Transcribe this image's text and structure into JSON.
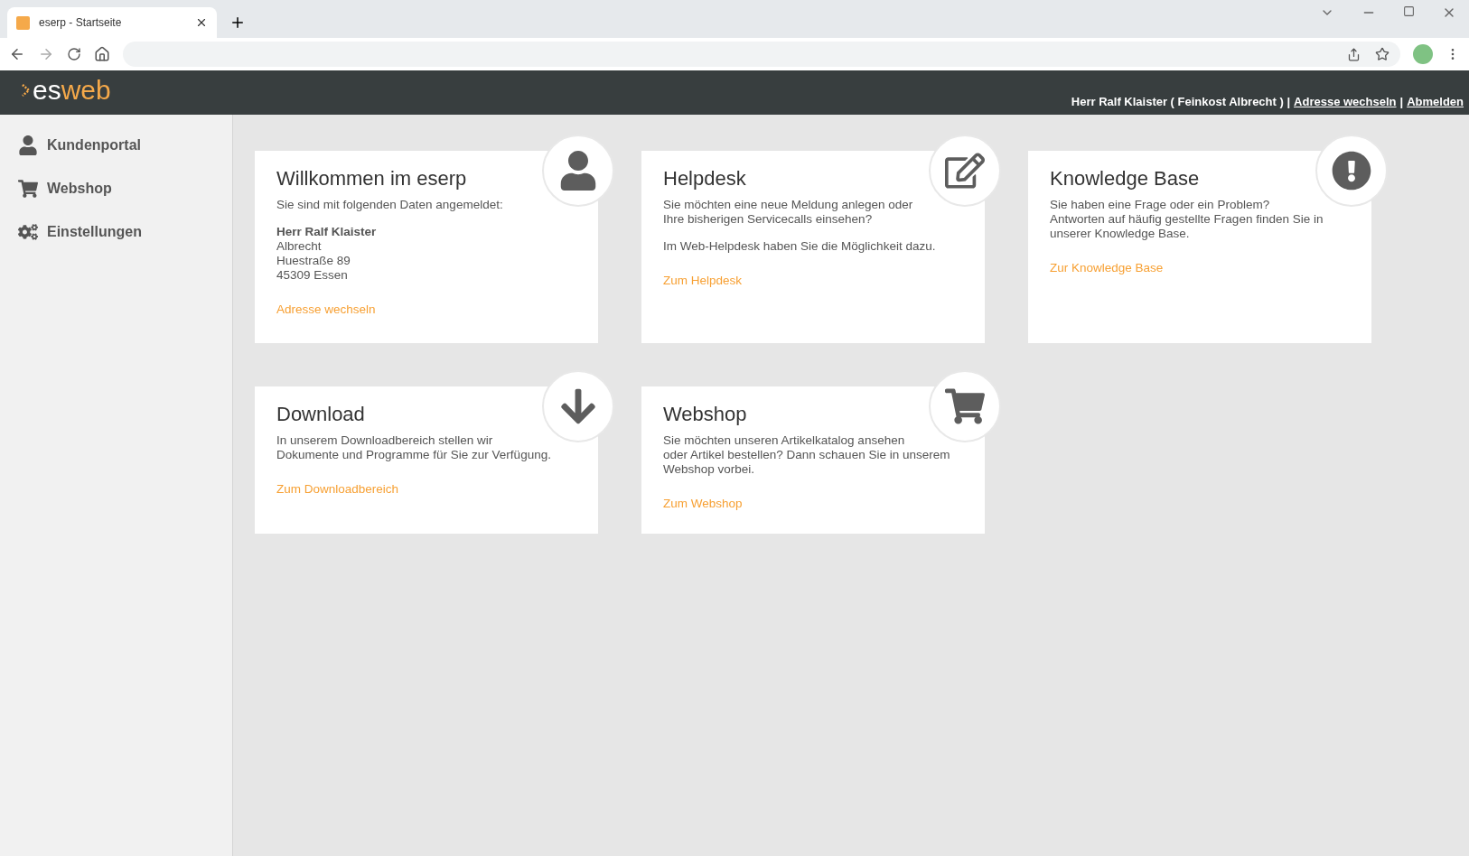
{
  "browser": {
    "tab_title": "eserp - Startseite"
  },
  "header": {
    "logo": [
      "es",
      "web"
    ],
    "user_bar": [
      {
        "kind": "text",
        "text": "Herr Ralf Klaister ( Feinkost Albrecht ) |"
      },
      {
        "kind": "link",
        "text": "Adresse wechseln"
      },
      {
        "kind": "text",
        "text": "|"
      },
      {
        "kind": "link",
        "text": "Abmelden"
      }
    ]
  },
  "sidebar": {
    "items": [
      {
        "label": "Kundenportal",
        "kind": "person"
      },
      {
        "label": "Webshop",
        "kind": "cart"
      },
      {
        "label": "Einstellungen",
        "kind": "gears"
      }
    ]
  },
  "cards": [
    {
      "title": "Willkommen im eserp",
      "kind": "person",
      "paragraphs": [
        [
          "Sie sind mit folgenden Daten angemeldet:"
        ],
        [
          "**Herr Ralf Klaister**",
          "Albrecht",
          "Huestraße 89",
          "45309 Essen"
        ]
      ],
      "link": "Adresse wechseln"
    },
    {
      "title": "Helpdesk",
      "kind": "edit",
      "paragraphs": [
        [
          "Sie möchten eine neue Meldung anlegen oder",
          "Ihre bisherigen Servicecalls einsehen?"
        ],
        [
          "Im Web-Helpdesk haben Sie die Möglichkeit dazu."
        ]
      ],
      "link": "Zum Helpdesk"
    },
    {
      "title": "Knowledge Base",
      "kind": "alert",
      "paragraphs": [
        [
          "Sie haben eine Frage oder ein Problem?",
          "Antworten auf häufig gestellte Fragen finden Sie in",
          "unserer Knowledge Base."
        ]
      ],
      "link": "Zur Knowledge Base"
    },
    {
      "title": "Download",
      "kind": "download",
      "paragraphs": [
        [
          "In unserem Downloadbereich stellen wir",
          "Dokumente und Programme für Sie zur Verfügung."
        ]
      ],
      "link": "Zum Downloadbereich"
    },
    {
      "title": "Webshop",
      "kind": "cart",
      "paragraphs": [
        [
          "Sie möchten unseren Artikelkatalog ansehen",
          "oder Artikel bestellen? Dann schauen Sie in unserem",
          "Webshop vorbei."
        ]
      ],
      "link": "Zum Webshop"
    }
  ]
}
